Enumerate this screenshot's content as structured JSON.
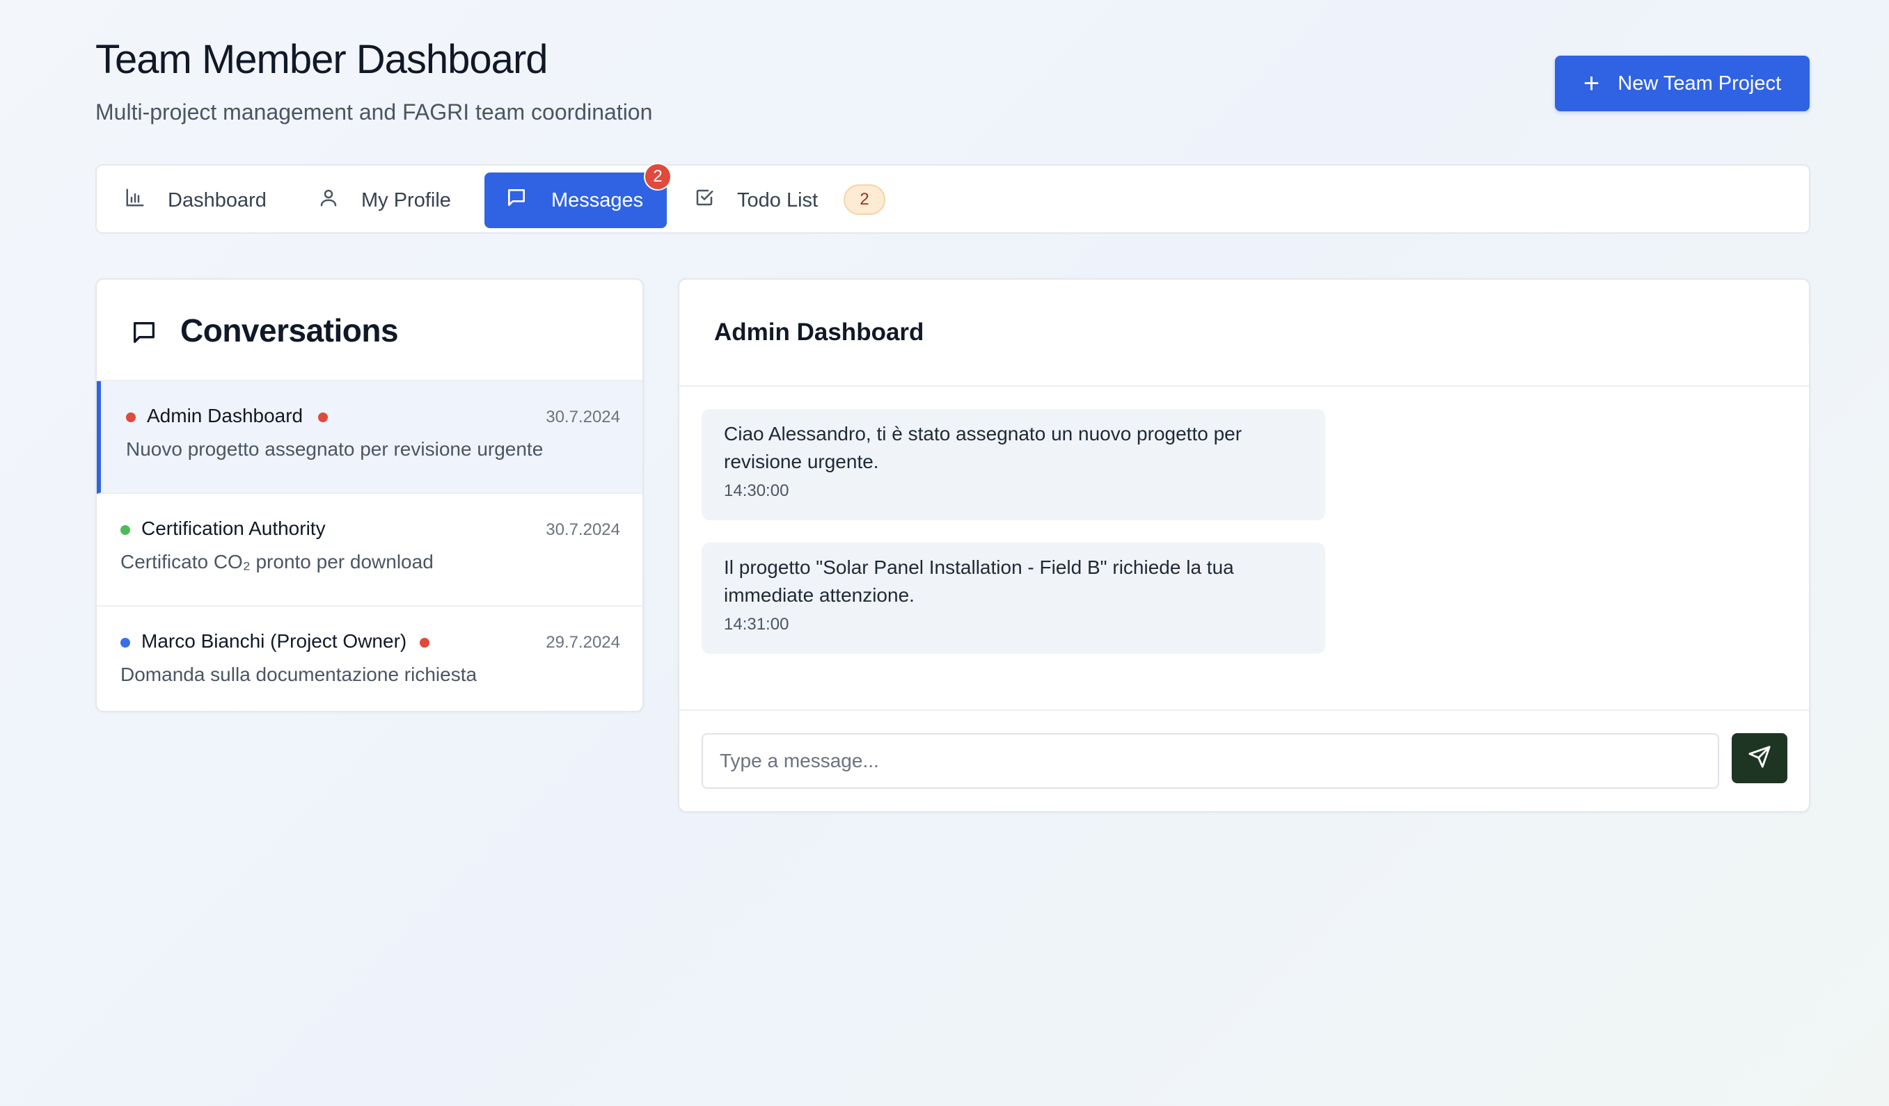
{
  "header": {
    "title": "Team Member Dashboard",
    "subtitle": "Multi-project management and FAGRI team coordination",
    "new_project_label": "New Team Project"
  },
  "tabs": [
    {
      "label": "Dashboard",
      "icon": "bar-chart-icon"
    },
    {
      "label": "My Profile",
      "icon": "user-icon"
    },
    {
      "label": "Messages",
      "icon": "message-icon",
      "badge": "2",
      "active": true
    },
    {
      "label": "Todo List",
      "icon": "checkbox-icon",
      "badge": "2"
    }
  ],
  "conversations": {
    "title": "Conversations",
    "items": [
      {
        "name": "Admin Dashboard",
        "date": "30.7.2024",
        "preview": "Nuovo progetto assegnato per revisione urgente",
        "status_color": "#e0493c",
        "unread": true,
        "active": true
      },
      {
        "name": "Certification Authority",
        "date": "30.7.2024",
        "preview": "Certificato CO₂ pronto per download",
        "status_color": "#4cbb5a",
        "unread": false,
        "active": false
      },
      {
        "name": "Marco Bianchi (Project Owner)",
        "date": "29.7.2024",
        "preview": "Domanda sulla documentazione richiesta",
        "status_color": "#3b6fe6",
        "unread": true,
        "active": false
      }
    ]
  },
  "chat": {
    "title": "Admin Dashboard",
    "messages": [
      {
        "line1": "Ciao Alessandro, ti è stato assegnato un nuovo progetto per",
        "line2": "revisione urgente.",
        "time": "14:30:00"
      },
      {
        "line1": "Il progetto \"Solar Panel Installation - Field B\" richiede la tua",
        "line2": "immediate attenzione.",
        "time": "14:31:00"
      }
    ],
    "input_placeholder": "Type a message...",
    "send_icon": "send-icon"
  },
  "colors": {
    "accent": "#2f63e3",
    "unread_dot": "#e0493c",
    "send_button": "#1f3524"
  }
}
